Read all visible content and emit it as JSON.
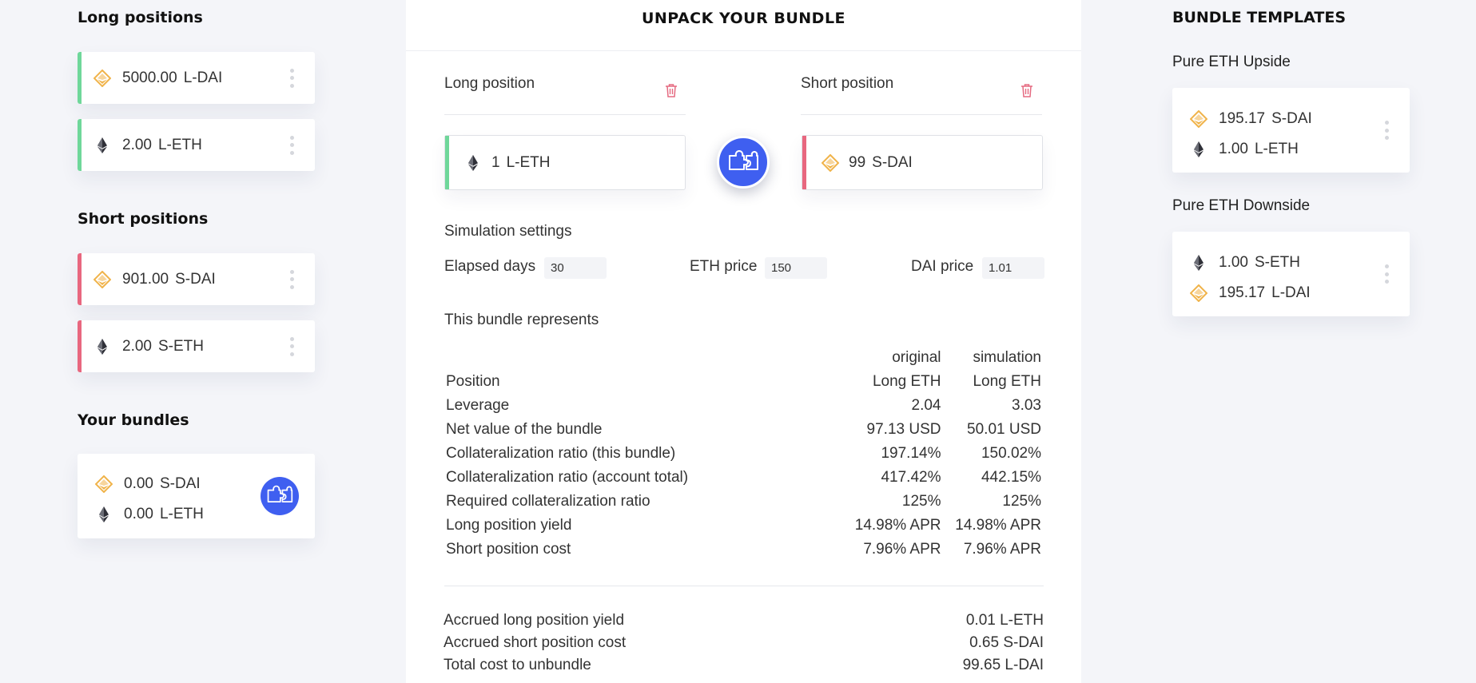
{
  "colors": {
    "accent": "#3f5ff0",
    "long": "#6fd79a",
    "short": "#e8677f",
    "dai": "#f0b34a",
    "eth": "#2f3038",
    "trash": "#e56a80"
  },
  "left": {
    "long_title": "Long positions",
    "long_items": [
      {
        "icon": "dai-icon",
        "amount": "5000.00",
        "symbol": "L-DAI"
      },
      {
        "icon": "eth-icon",
        "amount": "2.00",
        "symbol": "L-ETH"
      }
    ],
    "short_title": "Short positions",
    "short_items": [
      {
        "icon": "dai-icon",
        "amount": "901.00",
        "symbol": "S-DAI"
      },
      {
        "icon": "eth-icon",
        "amount": "2.00",
        "symbol": "S-ETH"
      }
    ],
    "bundles_title": "Your bundles",
    "bundle": [
      {
        "icon": "dai-icon",
        "amount": "0.00",
        "symbol": "S-DAI"
      },
      {
        "icon": "eth-icon",
        "amount": "0.00",
        "symbol": "L-ETH"
      }
    ]
  },
  "center": {
    "title": "UNPACK YOUR BUNDLE",
    "long_label": "Long position",
    "short_label": "Short position",
    "long_slot": {
      "amount": "1",
      "symbol": "L-ETH"
    },
    "short_slot": {
      "amount": "99",
      "symbol": "S-DAI"
    },
    "sim_title": "Simulation settings",
    "elapsed_label": "Elapsed days",
    "elapsed_value": "30",
    "eth_label": "ETH price",
    "eth_value": "150",
    "dai_label": "DAI price",
    "dai_value": "1.01",
    "represents": "This bundle represents",
    "headers": [
      "original",
      "simulation"
    ],
    "rows": [
      {
        "label": "Position",
        "original": "Long ETH",
        "simulation": "Long ETH"
      },
      {
        "label": "Leverage",
        "original": "2.04",
        "simulation": "3.03"
      },
      {
        "label": "Net value of the bundle",
        "original": "97.13 USD",
        "simulation": "50.01 USD"
      },
      {
        "label": "Collateralization ratio (this bundle)",
        "original": "197.14%",
        "simulation": "150.02%"
      },
      {
        "label": "Collateralization ratio (account total)",
        "original": "417.42%",
        "simulation": "442.15%"
      },
      {
        "label": "Required collateralization ratio",
        "original": "125%",
        "simulation": "125%"
      },
      {
        "label": "Long position yield",
        "original": "14.98% APR",
        "simulation": "14.98% APR"
      },
      {
        "label": "Short position cost",
        "original": "7.96% APR",
        "simulation": "7.96% APR"
      }
    ],
    "accrued": [
      {
        "label": "Accrued long position yield",
        "value": "0.01 L-ETH"
      },
      {
        "label": "Accrued short position cost",
        "value": "0.65 S-DAI"
      },
      {
        "label": "Total cost to unbundle",
        "value": "99.65 L-DAI"
      }
    ]
  },
  "right": {
    "title": "BUNDLE TEMPLATES",
    "templates": [
      {
        "name": "Pure ETH Upside",
        "items": [
          {
            "icon": "dai-icon",
            "amount": "195.17",
            "symbol": "S-DAI"
          },
          {
            "icon": "eth-icon",
            "amount": "1.00",
            "symbol": "L-ETH"
          }
        ]
      },
      {
        "name": "Pure ETH Downside",
        "items": [
          {
            "icon": "eth-icon",
            "amount": "1.00",
            "symbol": "S-ETH"
          },
          {
            "icon": "dai-icon",
            "amount": "195.17",
            "symbol": "L-DAI"
          }
        ]
      }
    ]
  }
}
